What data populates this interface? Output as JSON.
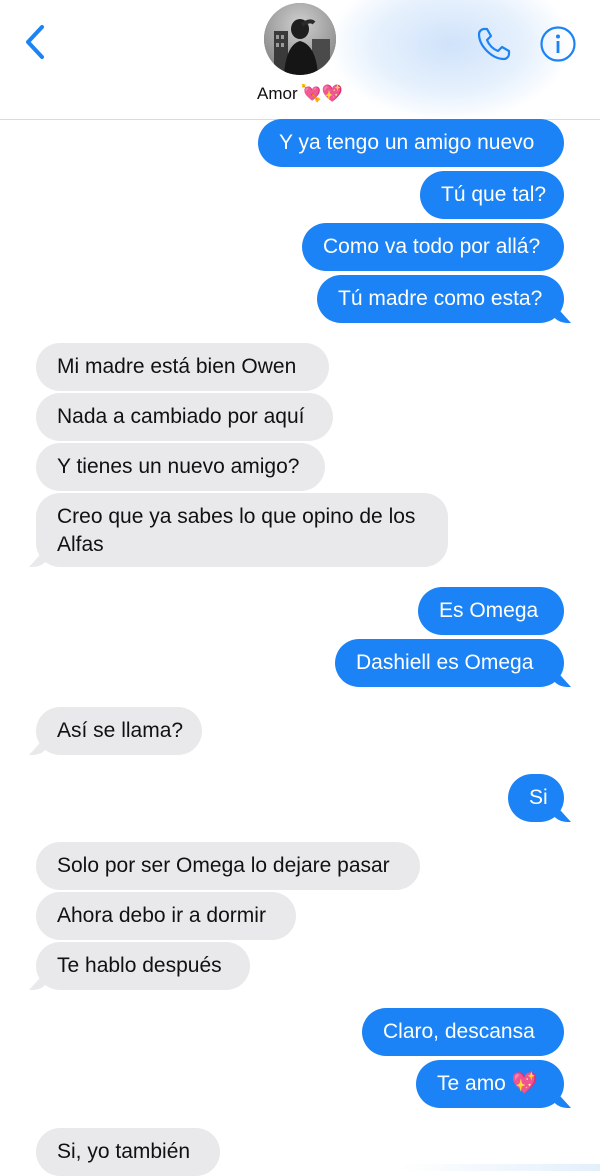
{
  "header": {
    "contact_name": "Amor",
    "contact_emojis": "💘💖",
    "back_icon": "chevron-left-icon",
    "call_icon": "phone-icon",
    "info_icon": "info-icon",
    "accent_color": "#1b83f5"
  },
  "messages": [
    {
      "side": "sent",
      "text": "Y ya tengo un amigo nuevo"
    },
    {
      "side": "sent",
      "text": "Tú que tal?"
    },
    {
      "side": "sent",
      "text": "Como va todo por allá?"
    },
    {
      "side": "sent",
      "text": "Tú madre como esta?"
    },
    {
      "side": "recv",
      "text": "Mi madre está bien Owen"
    },
    {
      "side": "recv",
      "text": "Nada a cambiado por aquí"
    },
    {
      "side": "recv",
      "text": "Y tienes un nuevo amigo?"
    },
    {
      "side": "recv",
      "text": "Creo que ya sabes lo que opino de los Alfas"
    },
    {
      "side": "sent",
      "text": "Es Omega"
    },
    {
      "side": "sent",
      "text": "Dashiell es Omega"
    },
    {
      "side": "recv",
      "text": "Así se llama?"
    },
    {
      "side": "sent",
      "text": "Si"
    },
    {
      "side": "recv",
      "text": "Solo por ser Omega lo dejare pasar"
    },
    {
      "side": "recv",
      "text": "Ahora debo ir a dormir"
    },
    {
      "side": "recv",
      "text": "Te hablo después"
    },
    {
      "side": "sent",
      "text": "Claro, descansa"
    },
    {
      "side": "sent",
      "text": "Te amo 💖"
    },
    {
      "side": "recv",
      "text": "Si, yo también"
    }
  ],
  "colors": {
    "sent_bubble": "#1b83f5",
    "received_bubble": "#e9e9eb"
  }
}
